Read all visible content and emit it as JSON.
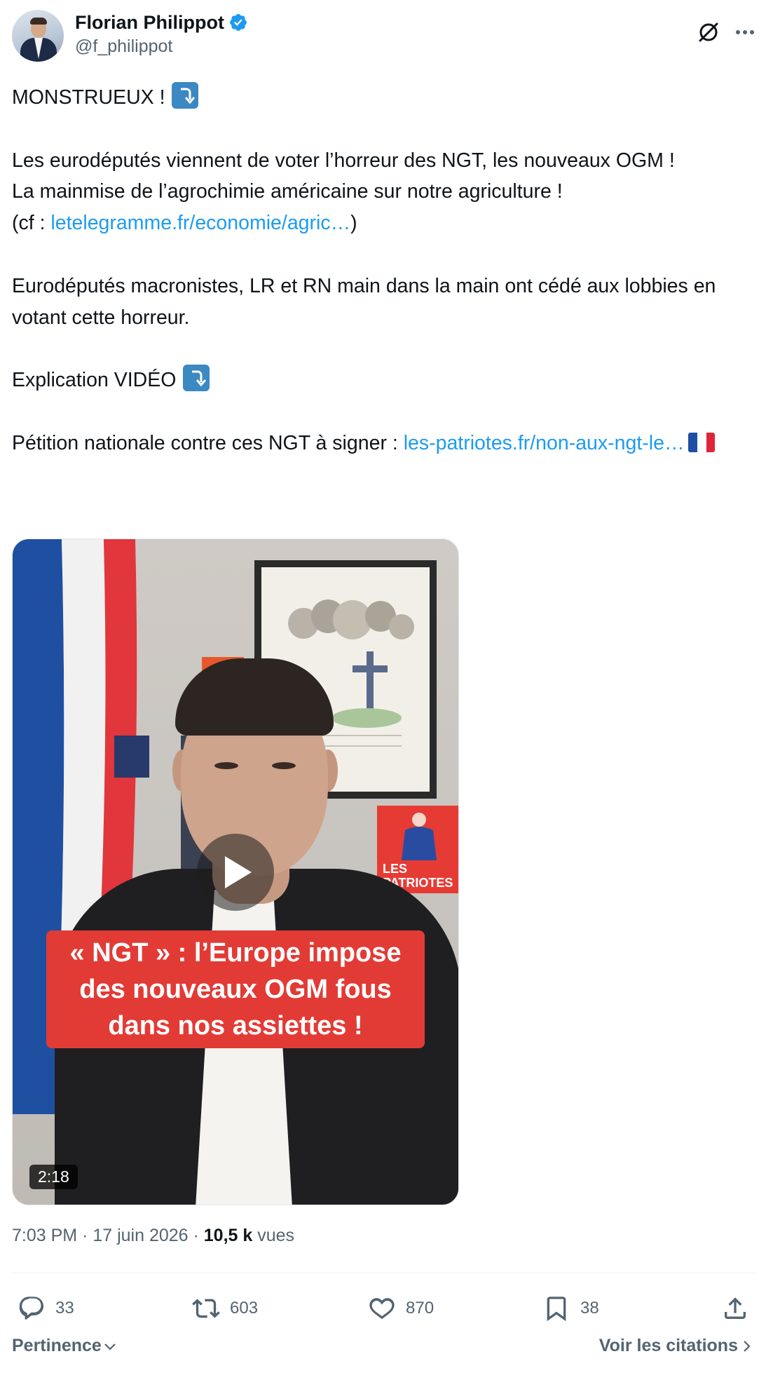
{
  "author": {
    "name": "Florian Philippot",
    "handle": "@f_philippot",
    "verified_color": "#1d9bf0"
  },
  "tweet": {
    "line1": "MONSTRUEUX ! ",
    "line2": "Les eurodéputés viennent de voter l’horreur des NGT, les nouveaux OGM !",
    "line3": "La mainmise de l’agrochimie américaine sur notre agriculture !",
    "line4_prefix": "(cf : ",
    "link1": "letelegramme.fr/economie/agric…",
    "line4_suffix": ")",
    "line5": "Eurodéputés macronistes, LR et RN main dans la main ont cédé aux lobbies en votant cette horreur.",
    "line6": "Explication VIDÉO ",
    "line7_prefix": "Pétition nationale contre ces NGT à signer : ",
    "link2": "les-patriotes.fr/non-aux-ngt-le…"
  },
  "media": {
    "caption": "« NGT » : l’Europe impose des nouveaux OGM fous dans nos assiettes !",
    "poster_text": "LES PATRIOTES",
    "duration": "2:18"
  },
  "meta": {
    "time": "7:03 PM",
    "sep": " · ",
    "date": "17 juin 2026",
    "views_count": "10,5 k",
    "views_label": " vues"
  },
  "actions": {
    "replies": "33",
    "retweets": "603",
    "likes": "870",
    "bookmarks": "38"
  },
  "footer": {
    "sort_label": "Pertinence",
    "quotes_label": "Voir les citations"
  },
  "colors": {
    "link": "#1d9bf0",
    "muted": "#536471",
    "caption_bg": "#e23b36"
  }
}
